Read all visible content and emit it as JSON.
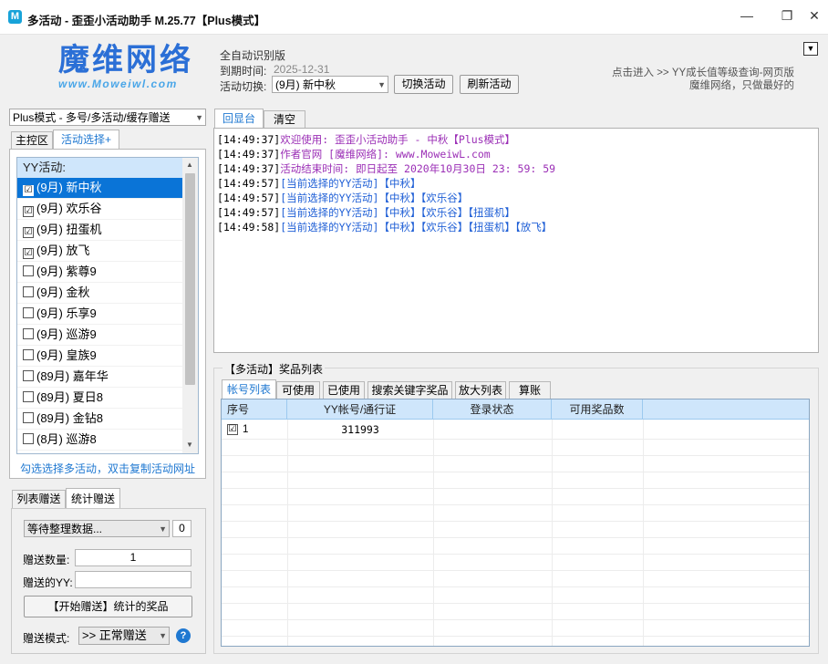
{
  "window": {
    "title": "多活动 - 歪歪小活动助手 M.25.77【Plus模式】",
    "icon_letter": "M",
    "minimize": "—",
    "restore": "❐",
    "close": "✕"
  },
  "brand": {
    "logo_text": "魔维网络",
    "logo_url": "www.Moweiwl.com"
  },
  "header": {
    "edition": "全自动识别版",
    "expire_label": "到期时间:",
    "expire_value": "2025-12-31",
    "switch_label": "活动切换:",
    "activity_selected": "(9月) 新中秋",
    "switch_button": "切换活动",
    "refresh_button": "刷新活动",
    "note_line1": "点击进入 >> YY成长值等级查询-网页版",
    "note_line2": "魔维网络，只做最好的"
  },
  "left": {
    "mode_select": "Plus模式 - 多号/多活动/缓存赠送",
    "tabs": [
      "主控区",
      "活动选择+"
    ],
    "list_header": "YY活动:",
    "activities": [
      {
        "label": "(9月) 新中秋",
        "checked": "☑"
      },
      {
        "label": "(9月) 欢乐谷",
        "checked": "☑"
      },
      {
        "label": "(9月) 扭蛋机",
        "checked": "☑"
      },
      {
        "label": "(9月) 放飞",
        "checked": "☑"
      },
      {
        "label": "(9月) 紫尊9",
        "checked": ""
      },
      {
        "label": "(9月) 金秋",
        "checked": ""
      },
      {
        "label": "(9月) 乐享9",
        "checked": ""
      },
      {
        "label": "(9月) 巡游9",
        "checked": ""
      },
      {
        "label": "(9月) 皇族9",
        "checked": ""
      },
      {
        "label": "(89月) 嘉年华",
        "checked": ""
      },
      {
        "label": "(89月) 夏日8",
        "checked": ""
      },
      {
        "label": "(89月) 金钻8",
        "checked": ""
      },
      {
        "label": "(8月) 巡游8",
        "checked": ""
      }
    ],
    "hint": "勾选选择多活动，双击复制活动网址",
    "gift_tabs": [
      "列表赠送",
      "统计赠送"
    ],
    "status_select": "等待整理数据...",
    "status_count": "0",
    "qty_label": "赠送数量:",
    "qty_value": "1",
    "yy_label": "赠送的YY:",
    "yy_value": "",
    "start_button": "【开始赠送】统计的奖品",
    "mode_label": "赠送模式:",
    "mode_value": ">> 正常赠送",
    "help_icon": "?"
  },
  "right": {
    "tabs": [
      "回显台",
      "清空"
    ],
    "log": [
      {
        "time": "[14:49:37]",
        "text": "欢迎使用: 歪歪小活动助手 - 中秋【Plus模式】",
        "color": "purple"
      },
      {
        "time": "[14:49:37]",
        "text": "作者官网 [魔维网络]: www.MoweiwL.com",
        "color": "purple"
      },
      {
        "time": "[14:49:37]",
        "text": "活动结束时间: 即日起至 2020年10月30日 23: 59: 59",
        "color": "purple"
      },
      {
        "time": "[14:49:57]",
        "text": "[当前选择的YY活动]【中秋】",
        "color": "blue"
      },
      {
        "time": "[14:49:57]",
        "text": "[当前选择的YY活动]【中秋】【欢乐谷】",
        "color": "blue"
      },
      {
        "time": "[14:49:57]",
        "text": "[当前选择的YY活动]【中秋】【欢乐谷】【扭蛋机】",
        "color": "blue"
      },
      {
        "time": "[14:49:58]",
        "text": "[当前选择的YY活动]【中秋】【欢乐谷】【扭蛋机】【放飞】",
        "color": "blue"
      }
    ],
    "prize_group_title": "【多活动】奖品列表",
    "prize_tabs": [
      "帐号列表",
      "可使用",
      "已使用",
      "搜索关键字奖品",
      "放大列表",
      "算账"
    ],
    "table_headers": [
      "序号",
      "YY帐号/通行证",
      "登录状态",
      "可用奖品数"
    ],
    "rows": [
      {
        "no": "1",
        "account": "311993",
        "status": "",
        "count": "",
        "checked": "☑"
      }
    ]
  }
}
